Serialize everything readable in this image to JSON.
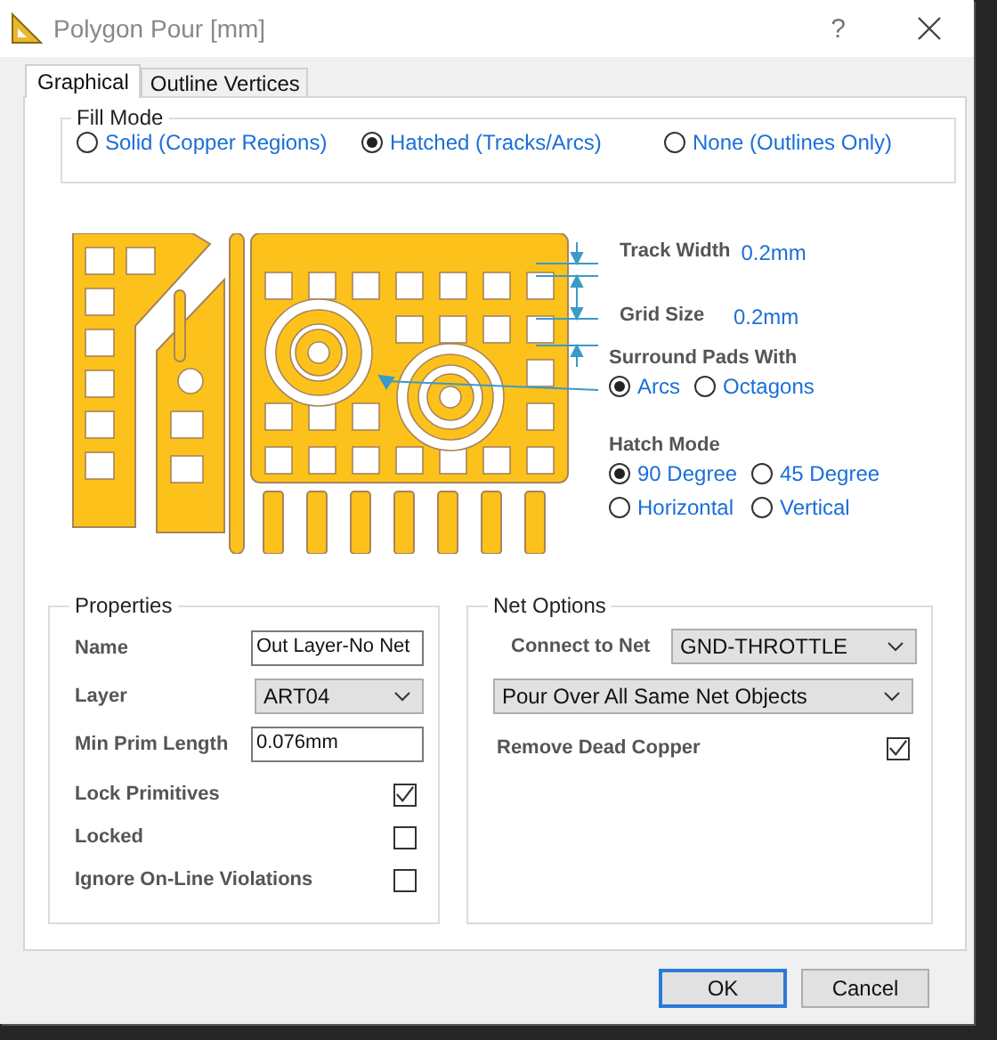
{
  "window": {
    "title": "Polygon Pour [mm]",
    "help": "?"
  },
  "tabs": [
    {
      "label": "Graphical",
      "selected": true
    },
    {
      "label": "Outline Vertices",
      "selected": false
    }
  ],
  "fill_mode": {
    "title": "Fill Mode",
    "options": [
      {
        "label": "Solid (Copper Regions)",
        "selected": false
      },
      {
        "label": "Hatched (Tracks/Arcs)",
        "selected": true
      },
      {
        "label": "None (Outlines Only)",
        "selected": false
      }
    ]
  },
  "preview": {
    "track_width": {
      "label": "Track Width",
      "value": "0.2mm"
    },
    "grid_size": {
      "label": "Grid Size",
      "value": "0.2mm"
    },
    "surround_pads": {
      "title": "Surround Pads With",
      "options": [
        {
          "label": "Arcs",
          "selected": true
        },
        {
          "label": "Octagons",
          "selected": false
        }
      ]
    },
    "hatch_mode": {
      "title": "Hatch Mode",
      "options": [
        {
          "label": "90 Degree",
          "selected": true
        },
        {
          "label": "45 Degree",
          "selected": false
        },
        {
          "label": "Horizontal",
          "selected": false
        },
        {
          "label": "Vertical",
          "selected": false
        }
      ]
    }
  },
  "properties": {
    "title": "Properties",
    "fields": [
      {
        "kind": "input",
        "label": "Name",
        "value": "Out Layer-No Net"
      },
      {
        "kind": "select",
        "label": "Layer",
        "value": "ART04"
      },
      {
        "kind": "input",
        "label": "Min Prim Length",
        "value": "0.076mm"
      }
    ],
    "checkboxes": [
      {
        "label": "Lock Primitives",
        "checked": true
      },
      {
        "label": "Locked",
        "checked": false
      },
      {
        "label": "Ignore On-Line Violations",
        "checked": false
      }
    ]
  },
  "net_options": {
    "title": "Net Options",
    "connect_to_net": {
      "label": "Connect to Net",
      "value": "GND-THROTTLE"
    },
    "pour_mode": {
      "value": "Pour Over All Same Net Objects"
    },
    "remove_dead_copper": {
      "label": "Remove Dead Copper",
      "checked": true
    }
  },
  "buttons": [
    {
      "label": "OK",
      "default": true
    },
    {
      "label": "Cancel",
      "default": false
    }
  ]
}
